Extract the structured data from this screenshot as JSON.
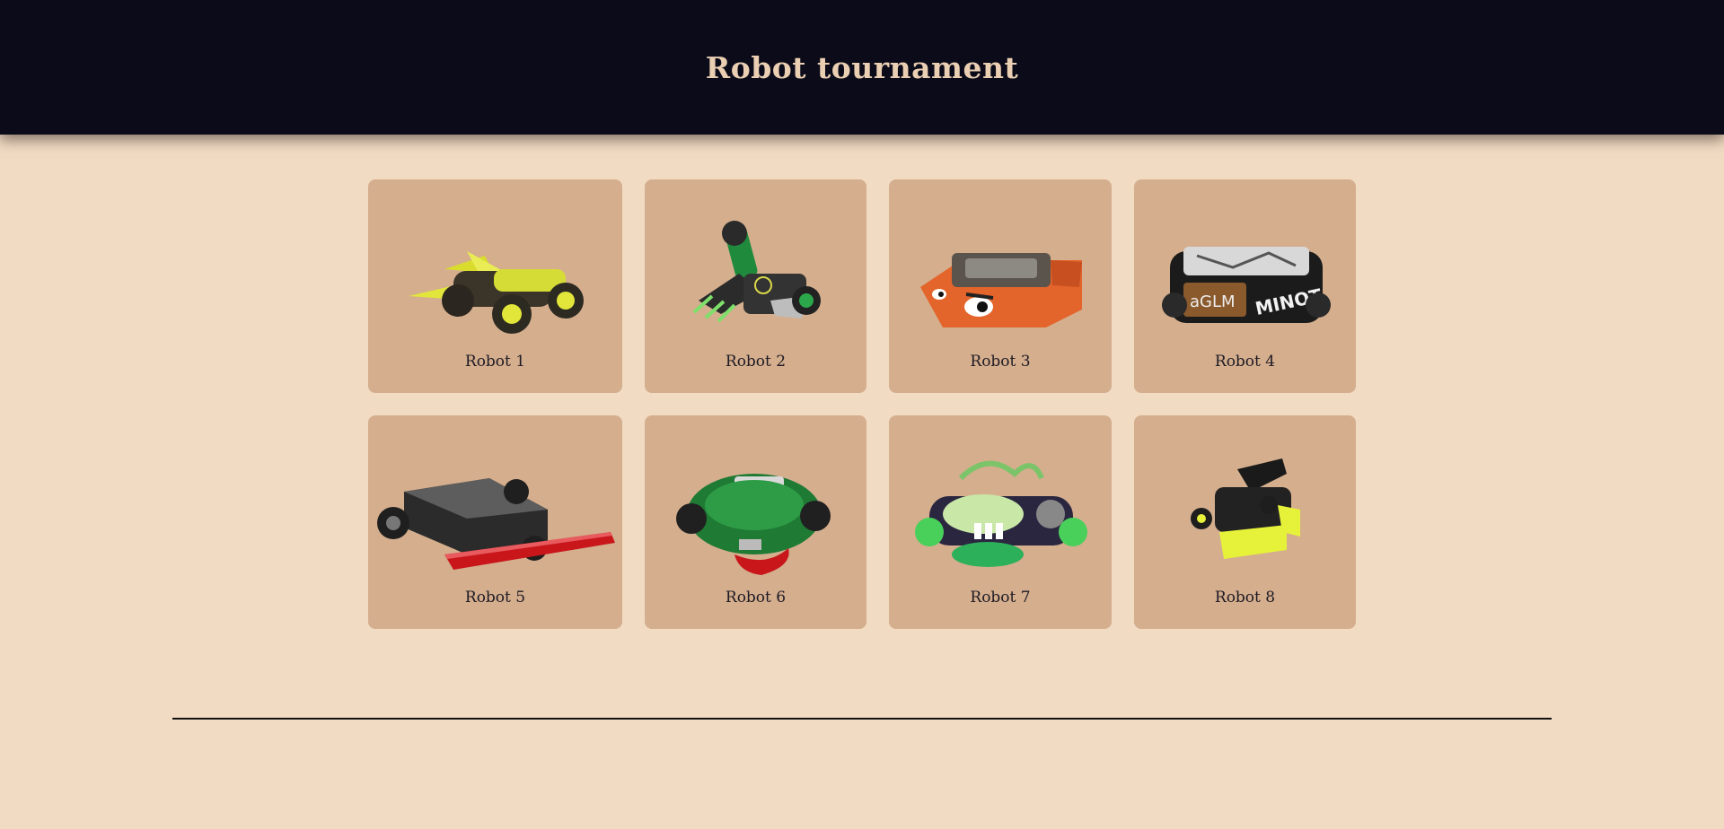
{
  "header": {
    "title": "Robot tournament",
    "background": "#0b0b1a",
    "title_color": "#ebcfb2"
  },
  "page": {
    "background": "#f1dbc3",
    "card_color": "#d4ae8d"
  },
  "robots": [
    {
      "label": "Robot 1",
      "icon": "robot-1-image",
      "accent": "#e2e63a"
    },
    {
      "label": "Robot 2",
      "icon": "robot-2-image",
      "accent": "#2ca84a"
    },
    {
      "label": "Robot 3",
      "icon": "robot-3-image",
      "accent": "#e3652b"
    },
    {
      "label": "Robot 4",
      "icon": "robot-4-image",
      "accent": "#e8e8e8"
    },
    {
      "label": "Robot 5",
      "icon": "robot-5-image",
      "accent": "#c8161b"
    },
    {
      "label": "Robot 6",
      "icon": "robot-6-image",
      "accent": "#1f7a34"
    },
    {
      "label": "Robot 7",
      "icon": "robot-7-image",
      "accent": "#48d05a"
    },
    {
      "label": "Robot 8",
      "icon": "robot-8-image",
      "accent": "#e6f23a"
    }
  ]
}
